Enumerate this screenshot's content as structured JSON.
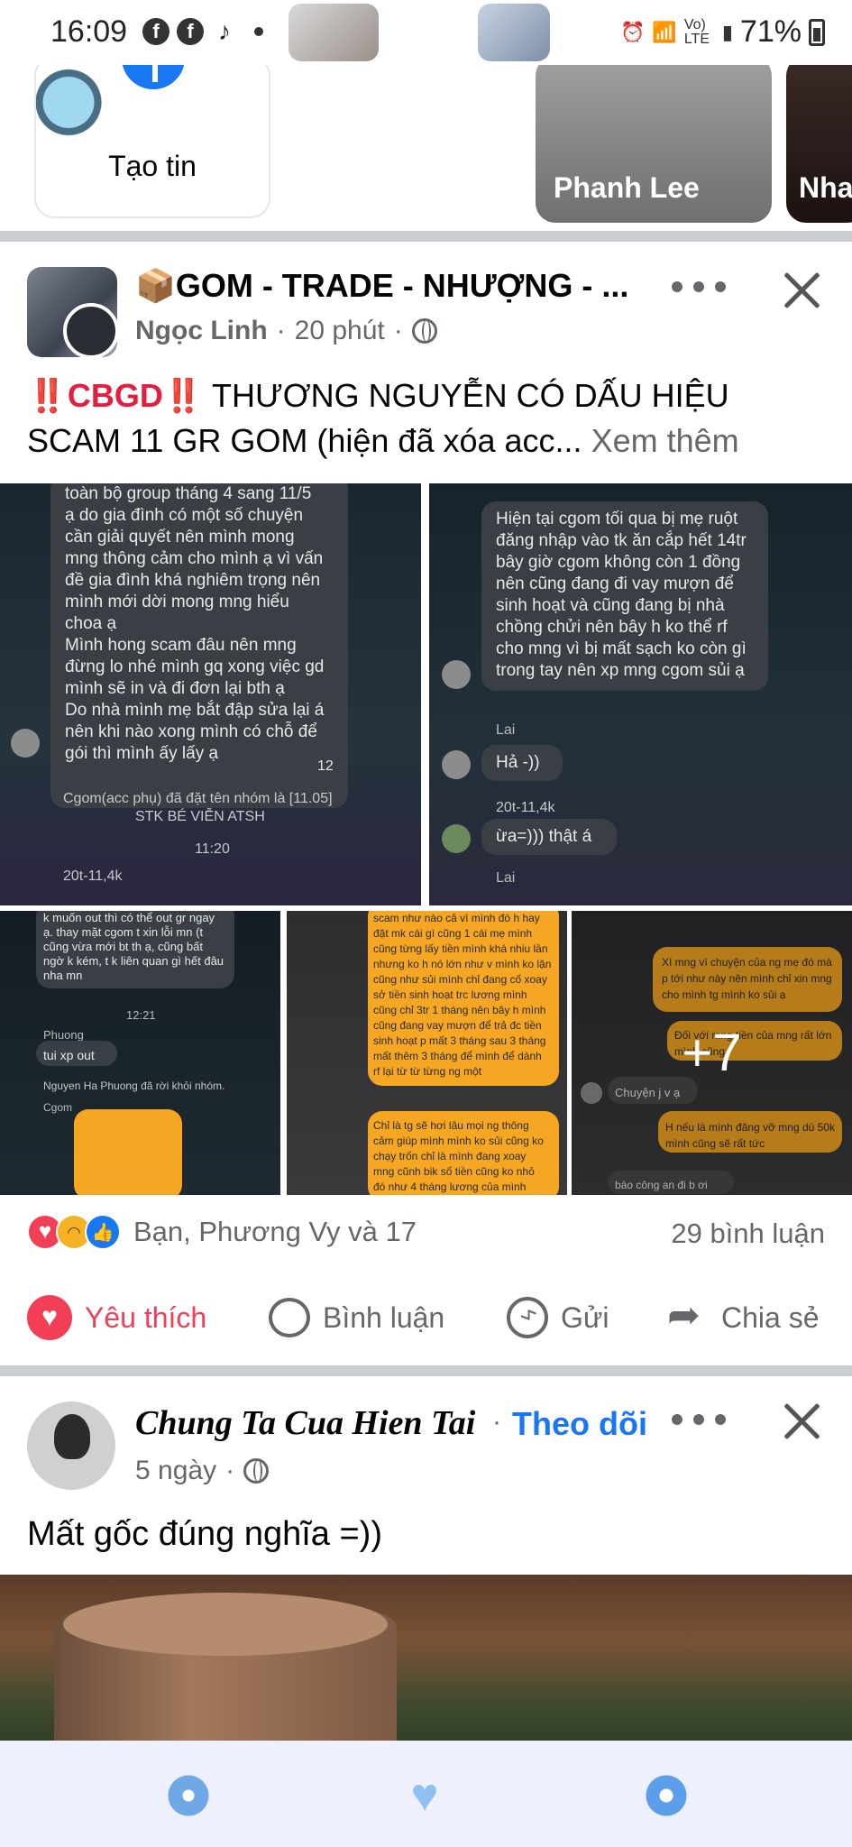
{
  "status_bar": {
    "time": "16:09",
    "network": "Vo) LTE",
    "battery": "71%"
  },
  "stories": {
    "create_label": "Tạo tin",
    "cards": [
      {
        "label": "Phanh Lee"
      },
      {
        "label": "Nha"
      }
    ]
  },
  "post1": {
    "group_name": "📦GOM - TRADE - NHƯỢNG - ...",
    "author": "Ngọc Linh",
    "time": "20 phút",
    "text_prefix": "‼️CBGD‼️",
    "text_body": " THƯƠNG NGUYỄN CÓ DẤU HIỆU SCAM 11 GR GOM (hiện đã xóa acc...",
    "see_more": " Xem thêm",
    "photo_more_count": "+7",
    "reactions_text": "Bạn, Phương Vy và 17",
    "comments_count": "29 bình luận",
    "actions": {
      "like": "Yêu thích",
      "comment": "Bình luận",
      "send": "Gửi",
      "share": "Chia sẻ"
    }
  },
  "screenshot1": {
    "lines": [
      "toàn bộ group tháng 4 sang 11/5",
      "ạ do gia đình có một số chuyện",
      "cần giải quyết nên mình mong",
      "mng thông cảm cho mình ạ vì vấn",
      "đề gia đình khá nghiêm trọng nên",
      "mình mới dời mong mng hiểu",
      "choa ạ",
      "Mình hong scam đâu nên mng",
      "đừng lo nhé mình gq xong việc gd",
      "mình sẽ in và đi đơn lại bth ạ",
      "Do nhà mình mẹ bắt đập sửa lại á",
      "nên khi nào xong mình có chỗ để",
      "gói thì mình ấy lấy ạ"
    ],
    "reaction_count": "12",
    "footer1": "Cgom(acc phụ) đã đặt tên nhóm là [11.05]",
    "footer2": "STK BÉ VIỄN ATSH",
    "time": "11:20",
    "tag": "20t-11,4k"
  },
  "screenshot2": {
    "lines": [
      "Hiện tại cgom tối qua bị mẹ ruột",
      "đăng nhập vào tk ăn cắp hết 14tr",
      "bây giờ cgom không còn 1 đồng",
      "nên cũng đang đi vay mượn để",
      "sinh hoạt và cũng đang bị nhà",
      "chồng chửi nên bây h ko thể rf",
      "cho mng vì bị mất sạch ko còn gì",
      "trong tay nên xp mng cgom sủi ạ"
    ],
    "name1": "Lai",
    "reply1": "Hả -))",
    "tag": "20t-11,4k",
    "reply2": "ừa=))) thật á",
    "name2": "Lai"
  },
  "screenshot3": {
    "top_lines": [
      "k muốn out thì có thể out gr ngay",
      "ạ. thay mặt cgom t xin lỗi mn (t",
      "cũng vừa mới bt th ạ, cũng bất",
      "ngờ k kém, t k liên quan gì hết đâu",
      "nha mn"
    ],
    "time": "12:21",
    "name": "Phuong",
    "msg": "tui xp out",
    "leave": "Nguyen Ha Phuong đã rời khỏi nhóm.",
    "name2": "Cgom"
  },
  "screenshot4": {
    "lines": [
      "scam như nào cả vì mình đó h hay",
      "đặt mk cái gì cũng 1 cái mẹ mình",
      "cũng từng lấy tiền mình khá nhiu lần",
      "nhưng ko h nó lớn như v mình ko lặn",
      "cũng như sủi mình chỉ đang cố xoay",
      "sở tiền sinh hoạt trc lương mình",
      "cũng chỉ 3tr 1 tháng nên bây h mình",
      "cũng đang vay mượn để trả đc tiền",
      "sinh hoạt p mất 3 tháng sau 3 tháng",
      "mất thêm 3 tháng để mình để dành",
      "rf lại từ từ từng ng một"
    ],
    "lines2": [
      "Chỉ là tg sẽ hơi lâu mọi ng thông",
      "cảm giúp mình mình ko sủi cũng ko",
      "chạy trốn chỉ là mình đang xoay",
      "mng cũnh bik số tiền cũng ko nhỏ",
      "đó như 4 tháng lương của mình"
    ]
  },
  "screenshot5": {
    "lines": [
      "XI mng vì chuyện của ng mẹ đó mà",
      "p tới như này nên mình chỉ xin mng",
      "cho mình tg mình ko sủi ạ"
    ],
    "msg2": "Đối với mng tiền của mng rất lớn",
    "msg2b": "mình cũng",
    "name": "Chuyện j v ạ",
    "msg3a": "H nếu là mình đăng vỡ mng dù 50k",
    "msg3b": "mình cũng sẽ rất tức",
    "msg4": "báo công an đi b ơi"
  },
  "post2": {
    "author": "Chung Ta Cua Hien Tai",
    "dot": "·",
    "follow": "Theo dõi",
    "time": "5 ngày",
    "text": "Mất gốc đúng nghĩa =))"
  },
  "colors": {
    "brand_blue": "#1877f2",
    "love_red": "#f33e58",
    "meta_gray": "#65676b",
    "divider": "#c9ccd1"
  },
  "icons": [
    "facebook-icon",
    "tiktok-icon",
    "plus-icon",
    "globe-icon",
    "more-icon",
    "close-icon",
    "heart-icon",
    "comment-icon",
    "messenger-icon",
    "share-icon"
  ]
}
